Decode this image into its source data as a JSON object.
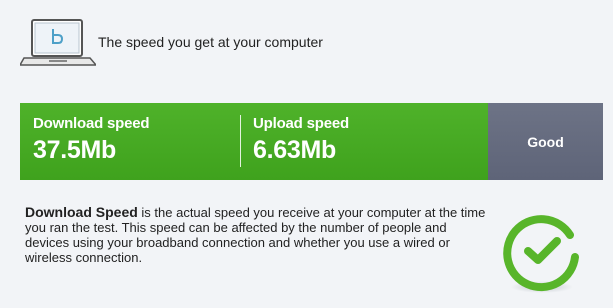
{
  "header": {
    "text": "The speed you get at your computer",
    "icon": "laptop-icon"
  },
  "speed": {
    "download_label": "Download speed",
    "download_value": "37.5Mb",
    "upload_label": "Upload speed",
    "upload_value": "6.63Mb",
    "rating": "Good"
  },
  "description": {
    "term": "Download Speed",
    "text": " is the actual speed you receive at your computer at the time you ran the test. This speed can be affected by the number of people and devices using your broadband connection and whether you use a wired or wireless connection."
  },
  "status": {
    "icon": "check-circle-icon",
    "color": "#58b52a"
  },
  "colors": {
    "green": "#45a824",
    "rating_bg": "#676d80"
  }
}
